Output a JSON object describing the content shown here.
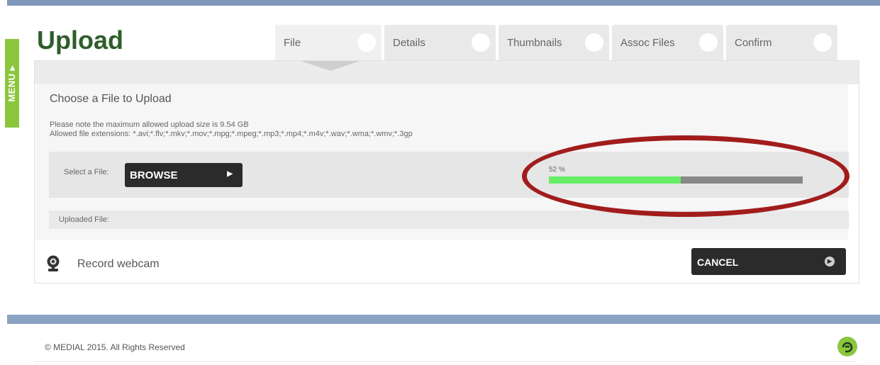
{
  "menu": {
    "label": "MENU ▸"
  },
  "page": {
    "title": "Upload"
  },
  "tabs": [
    {
      "label": "File",
      "active": true
    },
    {
      "label": "Details",
      "active": false
    },
    {
      "label": "Thumbnails",
      "active": false
    },
    {
      "label": "Assoc Files",
      "active": false
    },
    {
      "label": "Confirm",
      "active": false
    }
  ],
  "upload": {
    "section_title": "Choose a File to Upload",
    "max_size_note": "Please note the maximum allowed upload size is 9.54 GB",
    "extensions_note": "Allowed file extensions: *.avi;*.flv;*.mkv;*.mov;*.mpg;*.mpeg;*.mp3;*.mp4;*.m4v;*.wav;*.wma;*.wmv;*.3gp",
    "select_label": "Select a File:",
    "browse_label": "BROWSE",
    "browse_icon": "play-arrow-icon",
    "progress_text": "52 %",
    "progress_fraction": 0.52,
    "uploaded_label": "Uploaded File:"
  },
  "webcam": {
    "label": "Record webcam",
    "icon": "webcam-icon"
  },
  "cancel": {
    "label": "CANCEL",
    "icon": "play-circle-icon"
  },
  "footer": {
    "text": "© MEDIAL 2015. All Rights Reserved",
    "logo_icon": "medial-logo-icon"
  },
  "colors": {
    "brand_green": "#8cc63f",
    "title_green": "#2e5d2a",
    "progress_fill": "#66ee66",
    "progress_track": "#888888",
    "annotation_red": "#a11c1c",
    "top_bar": "#7f97b8"
  }
}
